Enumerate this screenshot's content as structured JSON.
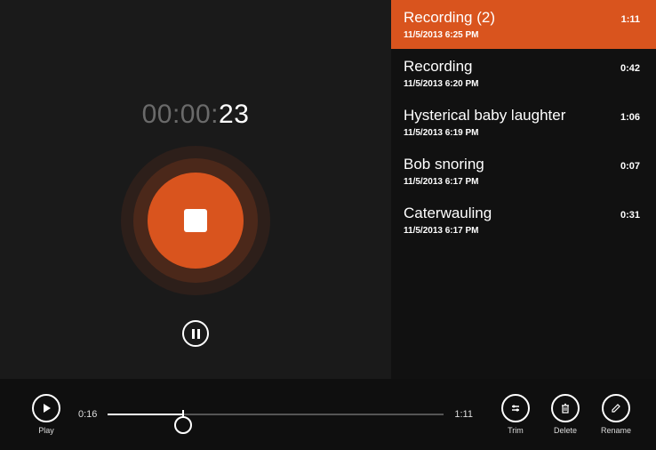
{
  "colors": {
    "accent": "#d9541e"
  },
  "timer": {
    "dim": "00:00:",
    "bright": "23"
  },
  "recordings": [
    {
      "title": "Recording (2)",
      "timestamp": "11/5/2013 6:25 PM",
      "duration": "1:11",
      "selected": true
    },
    {
      "title": "Recording",
      "timestamp": "11/5/2013 6:20 PM",
      "duration": "0:42",
      "selected": false
    },
    {
      "title": "Hysterical baby laughter",
      "timestamp": "11/5/2013 6:19 PM",
      "duration": "1:06",
      "selected": false
    },
    {
      "title": "Bob snoring",
      "timestamp": "11/5/2013 6:17 PM",
      "duration": "0:07",
      "selected": false
    },
    {
      "title": "Caterwauling",
      "timestamp": "11/5/2013 6:17 PM",
      "duration": "0:31",
      "selected": false
    }
  ],
  "playback": {
    "play_label": "Play",
    "current_time": "0:16",
    "total_time": "1:11",
    "progress_pct": 22.5
  },
  "actions": {
    "trim_label": "Trim",
    "delete_label": "Delete",
    "rename_label": "Rename"
  }
}
